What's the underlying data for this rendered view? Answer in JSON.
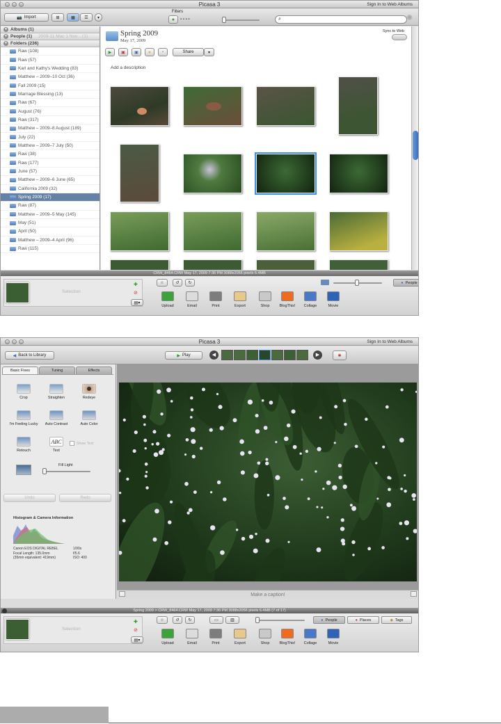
{
  "app_title": "Picasa 3",
  "sign_in": "Sign In to Web Albums",
  "w1": {
    "import_label": "Import",
    "filters_label": "Filters",
    "sections": {
      "albums": "Albums (1)",
      "people": "People (1)",
      "people_faint": "2009-11 Mac 1 Nov... (1)",
      "folders": "Folders (236)"
    },
    "folders": [
      "Raw (108)",
      "Raw (57)",
      "Karl and Kathy's Wedding (83)",
      "Matthew – 2009–10 Oct (36)",
      "Fall 2009 (15)",
      "Marriage Blessing (13)",
      "Raw (67)",
      "August (76)",
      "Raw (317)",
      "Matthew – 2009–8 August (189)",
      "July (22)",
      "Matthew – 2009–7 July (50)",
      "Raw (38)",
      "Raw (177)",
      "June (57)",
      "Matthew – 2009–6 June (65)",
      "California 2009 (32)",
      "Spring 2009 (17)",
      "Raw (87)",
      "Matthew – 2009–5 May (145)",
      "May (51)",
      "April (50)",
      "Matthew – 2009–4 April (96)",
      "Raw (115)"
    ],
    "selected_folder": "Spring 2009 (17)",
    "album_title": "Spring 2009",
    "album_date": "May 17, 2009",
    "sync_label": "Sync to Web",
    "share_label": "Share",
    "add_description": "Add a description",
    "status": "CRW_8464.CRW     May 17, 2009 7:36 PM     3088x2056 pixels     6.4MB",
    "selection_label": "Selection",
    "ptags": [
      "People",
      "Places",
      "Tags"
    ],
    "actions": [
      "Upload",
      "Email",
      "Print",
      "Export",
      "Shop",
      "BlogThis!",
      "Collage",
      "Movie"
    ]
  },
  "w2": {
    "back_label": "Back to Library",
    "play_label": "Play",
    "tabs": [
      "Basic Fixes",
      "Tuning",
      "Effects"
    ],
    "fixes": [
      "Crop",
      "Straighten",
      "Redeye",
      "I'm Feeling Lucky",
      "Auto Contrast",
      "Auto Color",
      "Retouch",
      "Text"
    ],
    "text_glyph": "ABC",
    "show_text": "Show Text",
    "fill_light": "Fill Light",
    "undo": "Undo",
    "redo": "Redo",
    "histogram_title": "Histogram & Camera Information",
    "camera_model": "Canon EOS DIGITAL REBEL",
    "focal_length": "Focal Length: 135.0mm",
    "equivalent": "(35mm equivalent: 419mm)",
    "shutter": "1/90s",
    "aperture": "f/5.6",
    "iso": "ISO: 400",
    "caption": "Make a caption!",
    "status": "Spring 2009 > CRW_8464.CRW     May 17, 2009 7:36 PM     3088x2056 pixels     6.4MB     (7 of 17)",
    "selection_label": "Selection"
  },
  "colors": {
    "accent": "#3e8ee6",
    "selected_row": "#6482a6"
  }
}
